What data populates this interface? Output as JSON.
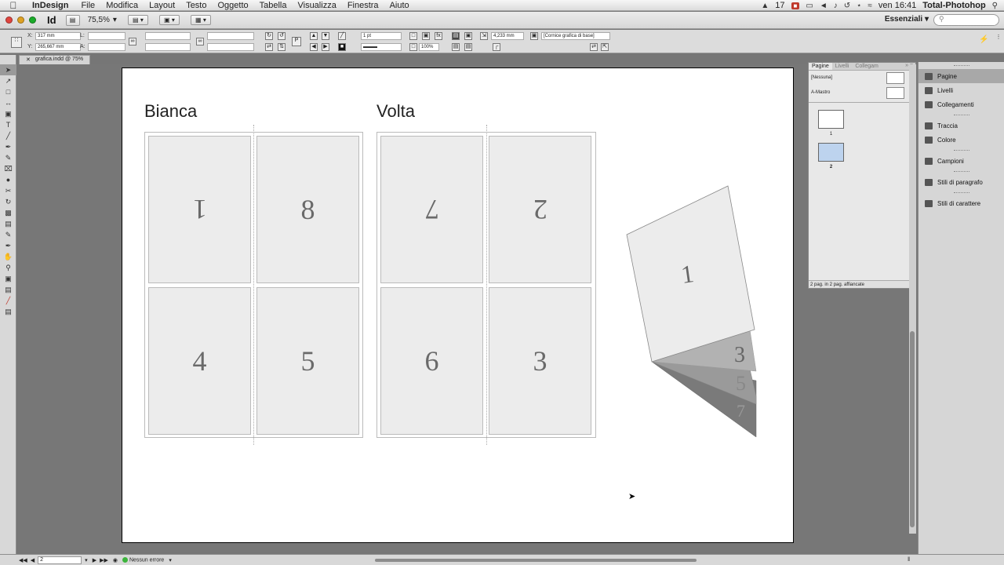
{
  "menubar": {
    "app_name": "InDesign",
    "items": [
      "File",
      "Modifica",
      "Layout",
      "Testo",
      "Oggetto",
      "Tabella",
      "Visualizza",
      "Finestra",
      "Aiuto"
    ],
    "status_counter": "17",
    "clock": "ven 16:41",
    "user": "Total-Photohop"
  },
  "toolbar": {
    "logo": "Id",
    "zoom": "75,5%",
    "workspace": "Essenziali"
  },
  "control_panel": {
    "x_label": "X:",
    "x_value": "317 mm",
    "y_label": "Y:",
    "y_value": "265,667 mm",
    "l_label": "L:",
    "a_label": "A:",
    "stroke_weight": "1 pt",
    "opacity": "100%",
    "dimension": "4,233 mm",
    "frame_style": "[Cornice grafica di base]"
  },
  "doc_tab": {
    "title": "grafica.indd @ 75%"
  },
  "page": {
    "sheets": [
      {
        "title": "Bianca",
        "cells": [
          {
            "label": "1",
            "flipped": true
          },
          {
            "label": "8",
            "flipped": false
          },
          {
            "label": "4",
            "flipped": false
          },
          {
            "label": "5",
            "flipped": false
          }
        ]
      },
      {
        "title": "Volta",
        "cells": [
          {
            "label": "7",
            "flipped": true
          },
          {
            "label": "2",
            "flipped": true
          },
          {
            "label": "6",
            "flipped": false
          },
          {
            "label": "3",
            "flipped": false
          }
        ]
      }
    ],
    "folded": {
      "front": "1",
      "layers": [
        "3",
        "5",
        "7"
      ]
    }
  },
  "pages_panel": {
    "tabs": [
      "Pagine",
      "Livelli",
      "Collegam"
    ],
    "masters": [
      "[Nessuna]",
      "A-Mastro"
    ],
    "pages": [
      {
        "number": "1"
      },
      {
        "number": "2"
      }
    ],
    "footer": "2 pag. in 2 pag. affiancate"
  },
  "dock": {
    "groups": [
      [
        {
          "label": "Pagine",
          "icon": "pages-icon",
          "selected": true
        },
        {
          "label": "Livelli",
          "icon": "layers-icon"
        },
        {
          "label": "Collegamenti",
          "icon": "links-icon"
        }
      ],
      [
        {
          "label": "Traccia",
          "icon": "stroke-icon"
        },
        {
          "label": "Colore",
          "icon": "color-icon"
        }
      ],
      [
        {
          "label": "Campioni",
          "icon": "swatches-icon"
        }
      ],
      [
        {
          "label": "Stili di paragrafo",
          "icon": "paragraph-styles-icon"
        }
      ],
      [
        {
          "label": "Stili di carattere",
          "icon": "character-styles-icon"
        }
      ]
    ]
  },
  "status": {
    "page": "2",
    "errors": "Nessun errore"
  }
}
